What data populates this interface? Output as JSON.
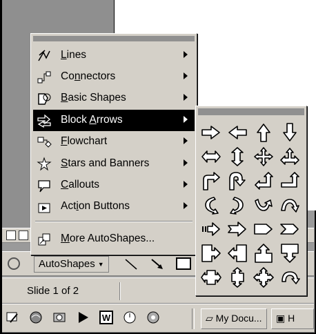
{
  "menu": {
    "items": [
      {
        "label_pre": "",
        "label_u": "L",
        "label_post": "ines",
        "icon": "lines-icon",
        "selected": false
      },
      {
        "label_pre": "Co",
        "label_u": "n",
        "label_post": "nectors",
        "icon": "connectors-icon",
        "selected": false
      },
      {
        "label_pre": "",
        "label_u": "B",
        "label_post": "asic Shapes",
        "icon": "basic-shapes-icon",
        "selected": false
      },
      {
        "label_pre": "Block ",
        "label_u": "A",
        "label_post": "rrows",
        "icon": "block-arrows-icon",
        "selected": true
      },
      {
        "label_pre": "",
        "label_u": "F",
        "label_post": "lowchart",
        "icon": "flowchart-icon",
        "selected": false
      },
      {
        "label_pre": "",
        "label_u": "S",
        "label_post": "tars and Banners",
        "icon": "stars-banners-icon",
        "selected": false
      },
      {
        "label_pre": "",
        "label_u": "C",
        "label_post": "allouts",
        "icon": "callouts-icon",
        "selected": false
      },
      {
        "label_pre": "Act",
        "label_u": "i",
        "label_post": "on Buttons",
        "icon": "action-buttons-icon",
        "selected": false
      }
    ],
    "more": {
      "label_pre": "",
      "label_u": "M",
      "label_post": "ore AutoShapes...",
      "icon": "more-autoshapes-icon"
    }
  },
  "submenu": {
    "title": "Block Arrows",
    "shapes": [
      "right-arrow",
      "left-arrow",
      "up-arrow",
      "down-arrow",
      "left-right-arrow",
      "up-down-arrow",
      "quad-arrow",
      "left-right-up-arrow",
      "bent-arrow",
      "u-turn-arrow",
      "left-up-arrow",
      "bent-up-arrow",
      "curved-right-arrow",
      "curved-left-arrow",
      "curved-up-arrow",
      "curved-down-arrow",
      "striped-right-arrow",
      "notched-right-arrow",
      "pentagon",
      "chevron",
      "right-arrow-callout",
      "left-arrow-callout",
      "up-arrow-callout",
      "down-arrow-callout",
      "left-right-arrow-callout",
      "up-down-arrow-callout",
      "quad-arrow-callout",
      "circular-arrow"
    ]
  },
  "drawing_toolbar": {
    "autoshapes_label": "AutoShapes"
  },
  "status_bar": {
    "slide_text": "Slide 1 of 2"
  },
  "taskbar": {
    "buttons": [
      {
        "label": "My Docu..."
      },
      {
        "label": "H"
      }
    ]
  }
}
